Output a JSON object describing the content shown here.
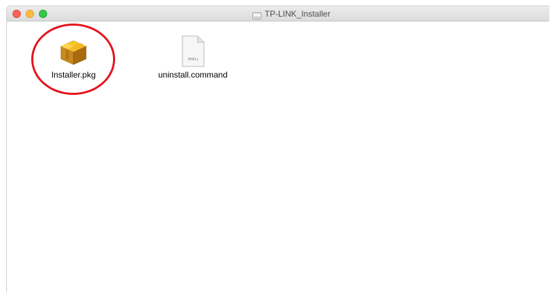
{
  "window": {
    "title": "TP-LINK_Installer"
  },
  "traffic_lights": {
    "close_color": "#fc605b",
    "minimize_color": "#fdbc40",
    "zoom_color": "#34c84a"
  },
  "files": [
    {
      "name": "Installer.pkg",
      "icon": "package-icon"
    },
    {
      "name": "uninstall.command",
      "icon": "shell-script-icon",
      "icon_text": "SHELL"
    }
  ],
  "annotation": {
    "highlight_color": "#e5141c"
  }
}
